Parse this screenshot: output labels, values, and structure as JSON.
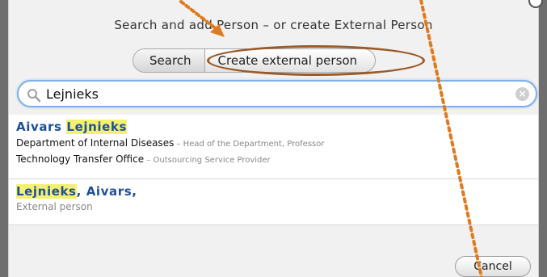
{
  "dialog": {
    "title": "Search and add Person – or create External Person"
  },
  "mode_switch": {
    "search_label": "Search",
    "create_label": "Create external person",
    "selected": "Search"
  },
  "search": {
    "value": "Lejnieks",
    "clear_symbol": "×"
  },
  "results": [
    {
      "name_first": "Aivars ",
      "name_match": "Lejnieks",
      "affiliations": [
        {
          "unit": "Department of Internal Diseases",
          "role": " – Head of the Department, Professor"
        },
        {
          "unit": "Technology Transfer Office",
          "role": " – Outsourcing Service Provider"
        }
      ]
    },
    {
      "name_match": "Lejnieks",
      "name_rest": ", Aivars,",
      "type_label": "External person"
    }
  ],
  "footer": {
    "cancel_label": "Cancel"
  },
  "annotation": {
    "arrow_color": "#e07a1f",
    "ring_color": "#9a5a28"
  },
  "colors": {
    "name_blue": "#1f4f9a",
    "match_highlight": "#f4f171",
    "focus_border": "#7fb0e8"
  }
}
